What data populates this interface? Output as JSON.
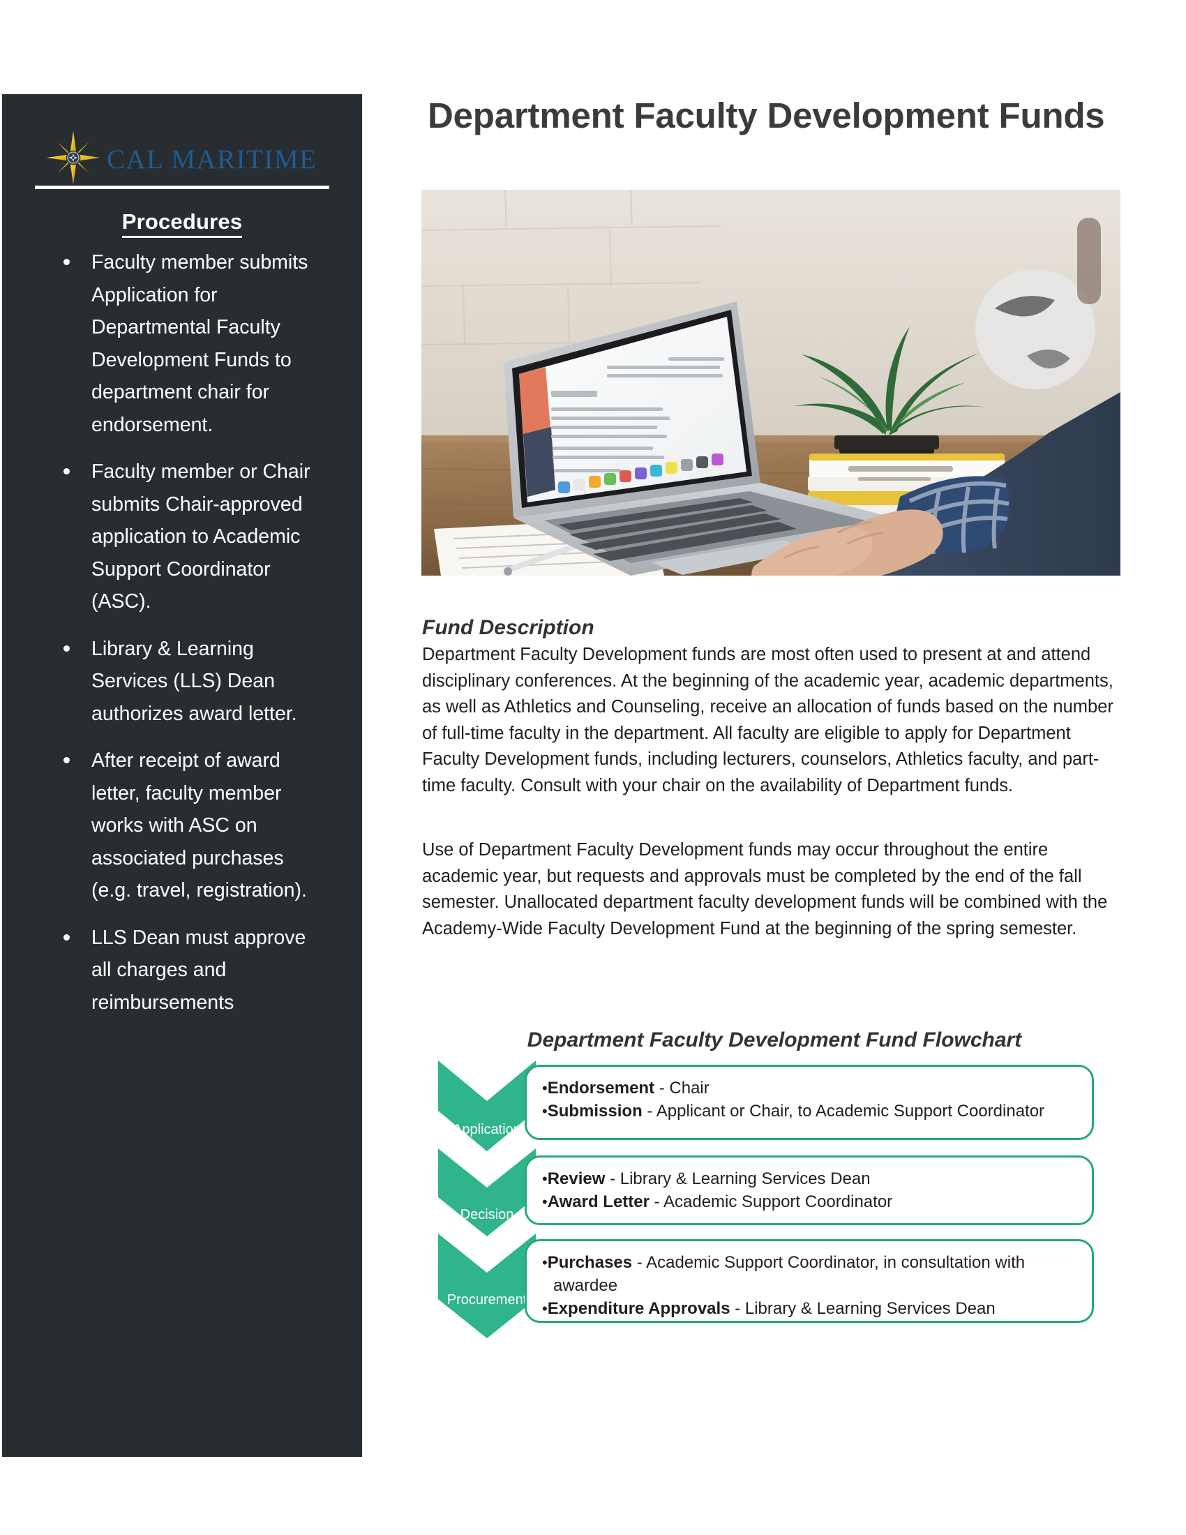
{
  "sidebar": {
    "logo": {
      "icon": "compass-star-icon",
      "wordmark": "CAL MARITIME",
      "star_color": "#f0c419",
      "star_core_color": "#1b3f7a",
      "wordmark_color": "#1f5c8f"
    },
    "background_color": "#282d32",
    "divider": "horizontal-rule",
    "heading": "Procedures",
    "items": [
      "Faculty member submits Application for Departmental Faculty Development Funds to department chair for endorsement.",
      "Faculty member or Chair submits Chair-approved application to Academic Support Coordinator (ASC).",
      "Library & Learning Services (LLS) Dean authorizes award letter.",
      "After receipt of award letter, faculty member works with ASC on associated purchases (e.g. travel, registration).",
      "LLS Dean must approve all charges and reimbursements"
    ]
  },
  "main": {
    "title": "Department Faculty Development Funds",
    "title_color": "#3b3b3b",
    "photo": {
      "name": "person-typing-on-laptop-photo",
      "alt": "Person in checkered shirt typing on a laptop at a wooden desk with a plant, stacked books and a teal coffee mug"
    },
    "fund_description": {
      "heading": "Fund Description",
      "paragraphs": [
        "Department Faculty Development funds are most often used to present at and attend disciplinary conferences. At the beginning of the academic year, academic departments, as well as Athletics and Counseling, receive an allocation of funds based on the number of full-time faculty in the department. All faculty are eligible to apply for Department Faculty Development funds, including lecturers, counselors, Athletics faculty, and part-time faculty. Consult with your chair on the availability of Department funds.",
        "Use of Department Faculty Development funds may occur throughout the entire academic year, but requests and approvals must be completed by the end of the fall semester. Unallocated department faculty development funds will be combined with the Academy-Wide Faculty Development Fund at the beginning of the spring semester."
      ]
    },
    "flowchart": {
      "title": "Department Faculty Development Fund Flowchart",
      "accent_color": "#2fb48c",
      "border_color": "#26a683",
      "stages": [
        {
          "label": "Application",
          "items": [
            {
              "term": "Endorsement",
              "sep": " - ",
              "detail": "Chair"
            },
            {
              "term": "Submission",
              "sep": " - ",
              "detail": "Applicant or Chair, to Academic Support Coordinator"
            }
          ]
        },
        {
          "label": "Decision",
          "items": [
            {
              "term": "Review",
              "sep": " - ",
              "detail": "Library & Learning Services Dean"
            },
            {
              "term": "Award Letter",
              "sep": " - ",
              "detail": "Academic Support Coordinator"
            }
          ]
        },
        {
          "label": "Procurement",
          "items": [
            {
              "term": "Purchases",
              "sep": " - ",
              "detail": "Academic Support Coordinator, in consultation with awardee"
            },
            {
              "term": "Expenditure Approvals",
              "sep": " - ",
              "detail": "Library & Learning Services Dean"
            }
          ]
        }
      ]
    }
  }
}
